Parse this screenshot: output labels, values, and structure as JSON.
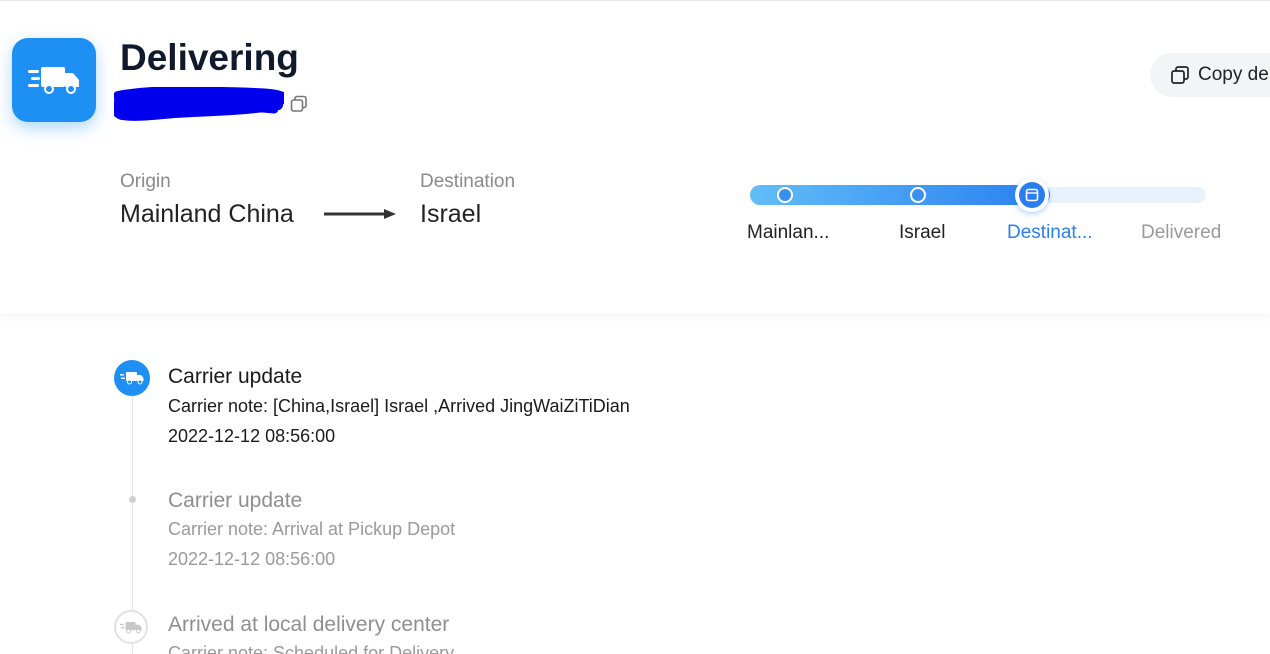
{
  "header": {
    "status_title": "Delivering",
    "copy_button_label": "Copy de",
    "icon": "delivery-truck-icon",
    "accent_color": "#1e90f4"
  },
  "route": {
    "origin_label": "Origin",
    "origin_value": "Mainland China",
    "destination_label": "Destination",
    "destination_value": "Israel"
  },
  "progress": {
    "steps": [
      {
        "label": "Mainlan..."
      },
      {
        "label": "Israel"
      },
      {
        "label": "Destinat..."
      },
      {
        "label": "Delivered"
      }
    ],
    "current_step": 3
  },
  "timeline": {
    "events": [
      {
        "title": "Carrier update",
        "note": "Carrier note: [China,Israel] Israel ,Arrived JingWaiZiTiDian",
        "time": "2022-12-12 08:56:00"
      },
      {
        "title": "Carrier update",
        "note": "Carrier note: Arrival at Pickup Depot",
        "time": "2022-12-12 08:56:00"
      },
      {
        "title": "Arrived at local delivery center",
        "note": "Carrier note: Scheduled for Delivery"
      }
    ]
  }
}
